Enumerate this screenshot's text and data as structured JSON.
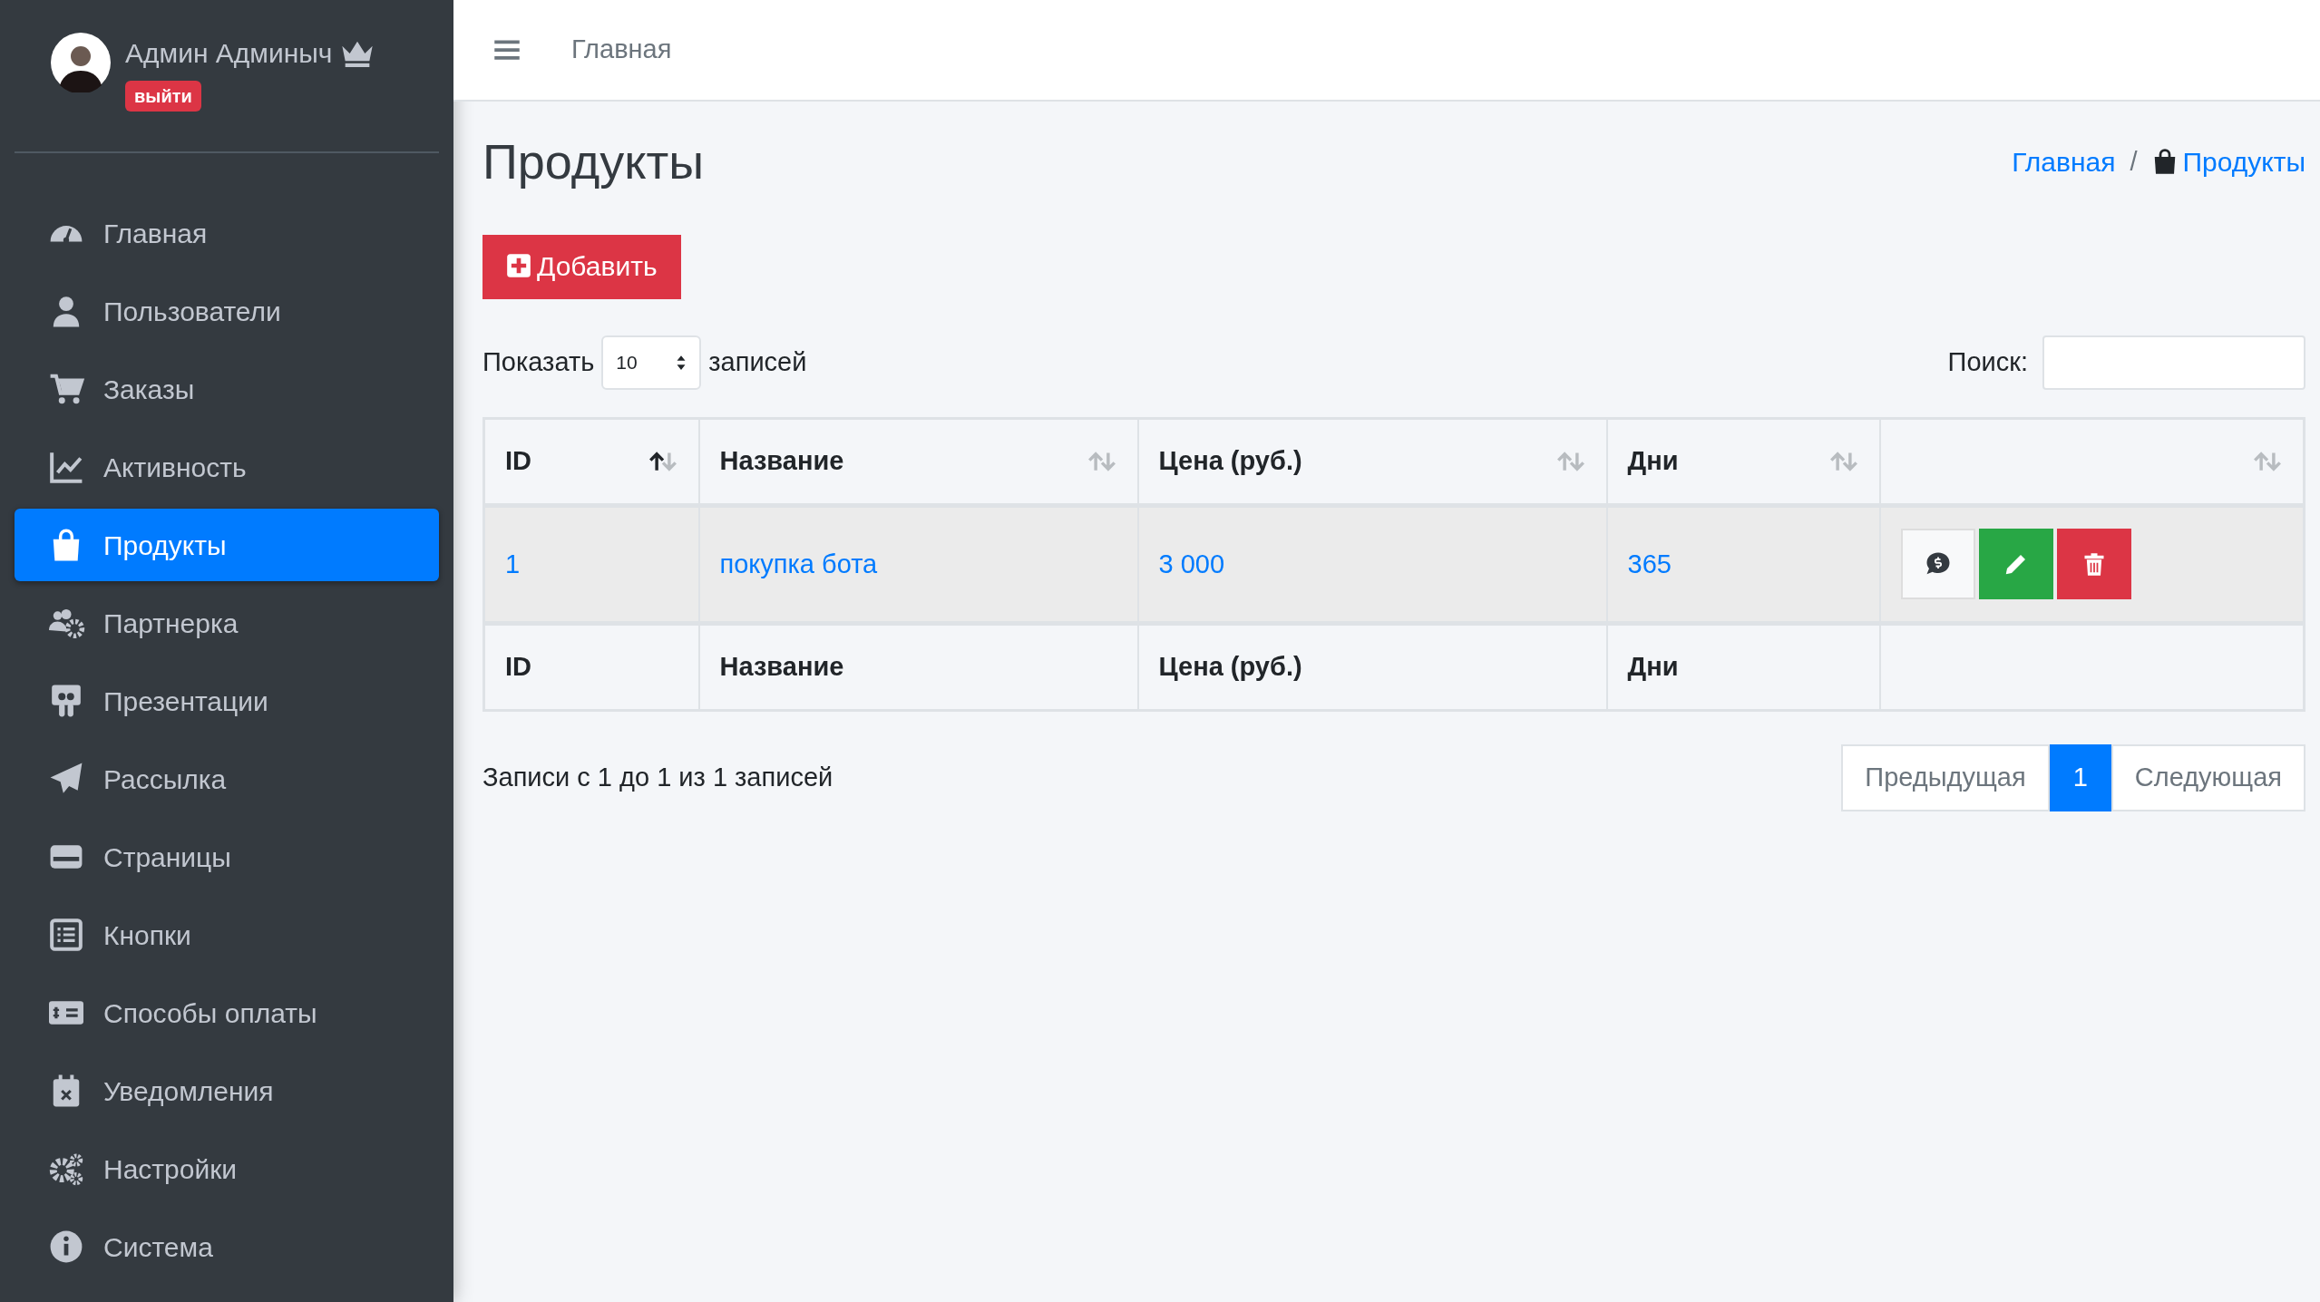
{
  "user": {
    "name": "Админ Админыч",
    "logout": "выйти"
  },
  "menu": [
    {
      "label": "Главная",
      "selected": false
    },
    {
      "label": "Пользователи",
      "selected": false
    },
    {
      "label": "Заказы",
      "selected": false
    },
    {
      "label": "Активность",
      "selected": false
    },
    {
      "label": "Продукты",
      "selected": true
    },
    {
      "label": "Партнерка",
      "selected": false
    },
    {
      "label": "Презентации",
      "selected": false
    },
    {
      "label": "Рассылка",
      "selected": false
    },
    {
      "label": "Страницы",
      "selected": false
    },
    {
      "label": "Кнопки",
      "selected": false
    },
    {
      "label": "Способы оплаты",
      "selected": false
    },
    {
      "label": "Уведомления",
      "selected": false
    },
    {
      "label": "Настройки",
      "selected": false
    },
    {
      "label": "Система",
      "selected": false
    }
  ],
  "topbar": {
    "link": "Главная"
  },
  "page": {
    "title": "Продукты",
    "breadcrumb_separator": "/",
    "breadcrumb": [
      {
        "label": "Главная",
        "kind": "link"
      },
      {
        "label": "Продукты",
        "kind": "current"
      }
    ]
  },
  "add_button": "Добавить",
  "length": {
    "label_before": "Показать",
    "value": "10",
    "label_after": "записей"
  },
  "search": {
    "label": "Поиск:"
  },
  "table": {
    "columns": [
      {
        "label": "ID",
        "sorted": true
      },
      {
        "label": "Название",
        "sorted": false
      },
      {
        "label": "Цена (руб.)",
        "sorted": false
      },
      {
        "label": "Дни",
        "sorted": false
      },
      {
        "sorted": false
      }
    ],
    "rows": [
      {
        "id": "1",
        "name": "покупка бота",
        "price": "3 000",
        "days": "365"
      }
    ],
    "footer": [
      "ID",
      "Название",
      "Цена (руб.)",
      "Дни"
    ]
  },
  "info": "Записи с 1 до 1 из 1 записей",
  "pagination": [
    {
      "label": "Предыдущая",
      "selected": false
    },
    {
      "label": "1",
      "selected": true
    },
    {
      "label": "Следующая",
      "selected": false
    }
  ]
}
